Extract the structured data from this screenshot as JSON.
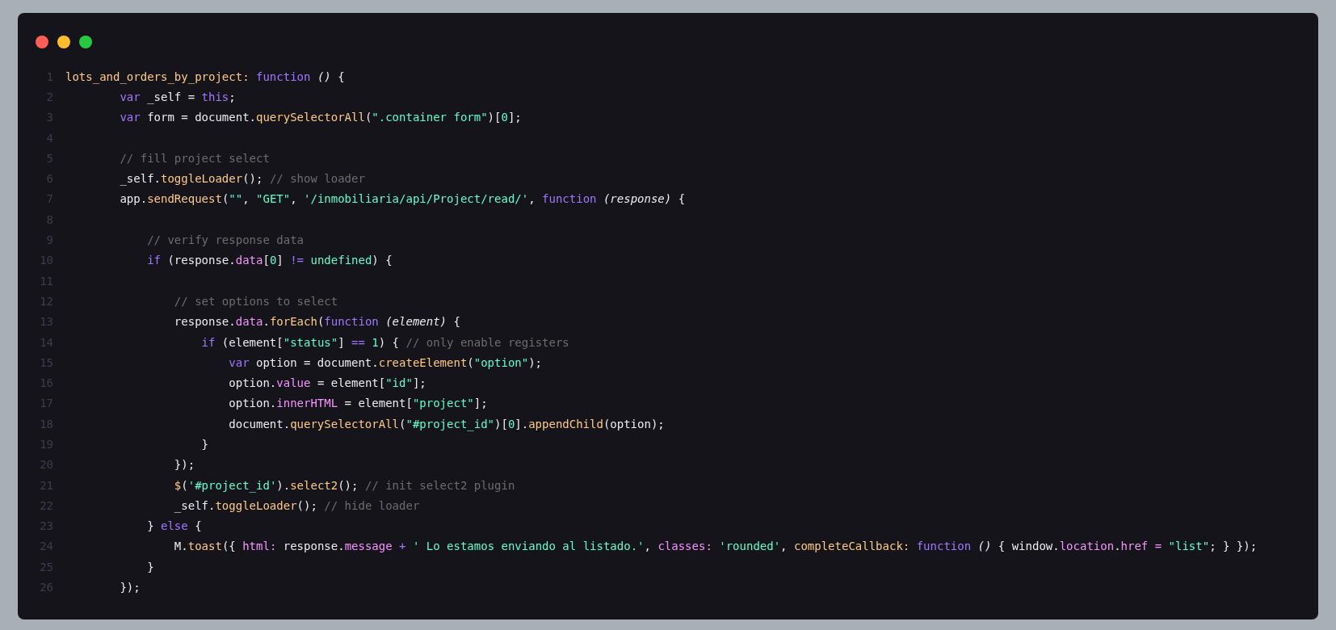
{
  "lines": [
    {
      "number": "1",
      "tokens": [
        {
          "kind": "method",
          "text": "lots_and_orders_by_project: "
        },
        {
          "kind": "keyword",
          "text": "function "
        },
        {
          "kind": "param",
          "text": "()"
        },
        {
          "kind": "plain",
          "text": " {"
        }
      ]
    },
    {
      "number": "2",
      "tokens": [
        {
          "kind": "keyword",
          "text": "        var"
        },
        {
          "kind": "plain",
          "text": " _self = "
        },
        {
          "kind": "keyword",
          "text": "this"
        },
        {
          "kind": "plain",
          "text": ";"
        }
      ]
    },
    {
      "number": "3",
      "tokens": [
        {
          "kind": "keyword",
          "text": "        var"
        },
        {
          "kind": "plain",
          "text": " form = document."
        },
        {
          "kind": "method",
          "text": "querySelectorAll"
        },
        {
          "kind": "plain",
          "text": "("
        },
        {
          "kind": "string",
          "text": "\".container form\""
        },
        {
          "kind": "plain",
          "text": ")["
        },
        {
          "kind": "number",
          "text": "0"
        },
        {
          "kind": "plain",
          "text": "];"
        }
      ]
    },
    {
      "number": "4"
    },
    {
      "number": "5",
      "tokens": [
        {
          "kind": "comment",
          "text": "        // fill project select"
        }
      ]
    },
    {
      "number": "6",
      "tokens": [
        {
          "kind": "plain",
          "text": "        _self."
        },
        {
          "kind": "method",
          "text": "toggleLoader"
        },
        {
          "kind": "plain",
          "text": "(); "
        },
        {
          "kind": "comment",
          "text": "// show loader"
        }
      ]
    },
    {
      "number": "7",
      "tokens": [
        {
          "kind": "plain",
          "text": "        app."
        },
        {
          "kind": "method",
          "text": "sendRequest"
        },
        {
          "kind": "plain",
          "text": "("
        },
        {
          "kind": "string",
          "text": "\"\""
        },
        {
          "kind": "plain",
          "text": ", "
        },
        {
          "kind": "string",
          "text": "\"GET\""
        },
        {
          "kind": "plain",
          "text": ", "
        },
        {
          "kind": "string",
          "text": "'/inmobiliaria/api/Project/read/'"
        },
        {
          "kind": "plain",
          "text": ", "
        },
        {
          "kind": "keyword",
          "text": "function "
        },
        {
          "kind": "param",
          "text": "(response)"
        },
        {
          "kind": "plain",
          "text": " {"
        }
      ]
    },
    {
      "number": "8"
    },
    {
      "number": "9",
      "tokens": [
        {
          "kind": "comment",
          "text": "            // verify response data"
        }
      ]
    },
    {
      "number": "10",
      "tokens": [
        {
          "kind": "keyword",
          "text": "            if"
        },
        {
          "kind": "plain",
          "text": " (response."
        },
        {
          "kind": "property",
          "text": "data"
        },
        {
          "kind": "plain",
          "text": "["
        },
        {
          "kind": "number",
          "text": "0"
        },
        {
          "kind": "plain",
          "text": "] "
        },
        {
          "kind": "keyword",
          "text": "!= "
        },
        {
          "kind": "string",
          "text": "undefined"
        },
        {
          "kind": "plain",
          "text": ") {"
        }
      ]
    },
    {
      "number": "11"
    },
    {
      "number": "12",
      "tokens": [
        {
          "kind": "comment",
          "text": "                // set options to select"
        }
      ]
    },
    {
      "number": "13",
      "tokens": [
        {
          "kind": "plain",
          "text": "                response."
        },
        {
          "kind": "property",
          "text": "data"
        },
        {
          "kind": "plain",
          "text": "."
        },
        {
          "kind": "method",
          "text": "forEach"
        },
        {
          "kind": "plain",
          "text": "("
        },
        {
          "kind": "keyword",
          "text": "function "
        },
        {
          "kind": "param",
          "text": "(element)"
        },
        {
          "kind": "plain",
          "text": " {"
        }
      ]
    },
    {
      "number": "14",
      "tokens": [
        {
          "kind": "keyword",
          "text": "                    if"
        },
        {
          "kind": "plain",
          "text": " (element["
        },
        {
          "kind": "string",
          "text": "\"status\""
        },
        {
          "kind": "plain",
          "text": "] "
        },
        {
          "kind": "keyword",
          "text": "== "
        },
        {
          "kind": "number",
          "text": "1"
        },
        {
          "kind": "plain",
          "text": ") { "
        },
        {
          "kind": "comment",
          "text": "// only enable registers"
        }
      ]
    },
    {
      "number": "15",
      "tokens": [
        {
          "kind": "keyword",
          "text": "                        var"
        },
        {
          "kind": "plain",
          "text": " option = document."
        },
        {
          "kind": "method",
          "text": "createElement"
        },
        {
          "kind": "plain",
          "text": "("
        },
        {
          "kind": "string",
          "text": "\"option\""
        },
        {
          "kind": "plain",
          "text": ");"
        }
      ]
    },
    {
      "number": "16",
      "tokens": [
        {
          "kind": "plain",
          "text": "                        option."
        },
        {
          "kind": "property",
          "text": "value"
        },
        {
          "kind": "plain",
          "text": " = element["
        },
        {
          "kind": "string",
          "text": "\"id\""
        },
        {
          "kind": "plain",
          "text": "];"
        }
      ]
    },
    {
      "number": "17",
      "tokens": [
        {
          "kind": "plain",
          "text": "                        option."
        },
        {
          "kind": "property",
          "text": "innerHTML"
        },
        {
          "kind": "plain",
          "text": " = element["
        },
        {
          "kind": "string",
          "text": "\"project\""
        },
        {
          "kind": "plain",
          "text": "];"
        }
      ]
    },
    {
      "number": "18",
      "tokens": [
        {
          "kind": "plain",
          "text": "                        document."
        },
        {
          "kind": "method",
          "text": "querySelectorAll"
        },
        {
          "kind": "plain",
          "text": "("
        },
        {
          "kind": "string",
          "text": "\"#project_id\""
        },
        {
          "kind": "plain",
          "text": ")["
        },
        {
          "kind": "number",
          "text": "0"
        },
        {
          "kind": "plain",
          "text": "]."
        },
        {
          "kind": "method",
          "text": "appendChild"
        },
        {
          "kind": "plain",
          "text": "(option);"
        }
      ]
    },
    {
      "number": "19",
      "tokens": [
        {
          "kind": "plain",
          "text": "                    }"
        }
      ]
    },
    {
      "number": "20",
      "tokens": [
        {
          "kind": "plain",
          "text": "                });"
        }
      ]
    },
    {
      "number": "21",
      "tokens": [
        {
          "kind": "method",
          "text": "                $"
        },
        {
          "kind": "plain",
          "text": "("
        },
        {
          "kind": "string",
          "text": "'#project_id'"
        },
        {
          "kind": "plain",
          "text": ")."
        },
        {
          "kind": "method",
          "text": "select2"
        },
        {
          "kind": "plain",
          "text": "(); "
        },
        {
          "kind": "comment",
          "text": "// init select2 plugin"
        }
      ]
    },
    {
      "number": "22",
      "tokens": [
        {
          "kind": "plain",
          "text": "                _self."
        },
        {
          "kind": "method",
          "text": "toggleLoader"
        },
        {
          "kind": "plain",
          "text": "(); "
        },
        {
          "kind": "comment",
          "text": "// hide loader"
        }
      ]
    },
    {
      "number": "23",
      "tokens": [
        {
          "kind": "plain",
          "text": "            } "
        },
        {
          "kind": "keyword",
          "text": "else"
        },
        {
          "kind": "plain",
          "text": " {"
        }
      ]
    },
    {
      "number": "24",
      "tokens": [
        {
          "kind": "plain",
          "text": "                M."
        },
        {
          "kind": "method",
          "text": "toast"
        },
        {
          "kind": "plain",
          "text": "({ "
        },
        {
          "kind": "property",
          "text": "html:"
        },
        {
          "kind": "plain",
          "text": " response."
        },
        {
          "kind": "property",
          "text": "message"
        },
        {
          "kind": "keyword",
          "text": " + "
        },
        {
          "kind": "string",
          "text": "' Lo estamos enviando al listado.'"
        },
        {
          "kind": "plain",
          "text": ", "
        },
        {
          "kind": "property",
          "text": "classes: "
        },
        {
          "kind": "string",
          "text": "'rounded'"
        },
        {
          "kind": "plain",
          "text": ", "
        },
        {
          "kind": "method",
          "text": "completeCallback: "
        },
        {
          "kind": "keyword",
          "text": "function "
        },
        {
          "kind": "param",
          "text": "()"
        },
        {
          "kind": "plain",
          "text": " { window."
        },
        {
          "kind": "property",
          "text": "location"
        },
        {
          "kind": "plain",
          "text": "."
        },
        {
          "kind": "property",
          "text": "href = "
        },
        {
          "kind": "string",
          "text": "\"list\""
        },
        {
          "kind": "plain",
          "text": "; } });"
        }
      ]
    },
    {
      "number": "25",
      "tokens": [
        {
          "kind": "plain",
          "text": "            }"
        }
      ]
    },
    {
      "number": "26",
      "tokens": [
        {
          "kind": "plain",
          "text": "        });"
        }
      ]
    }
  ]
}
